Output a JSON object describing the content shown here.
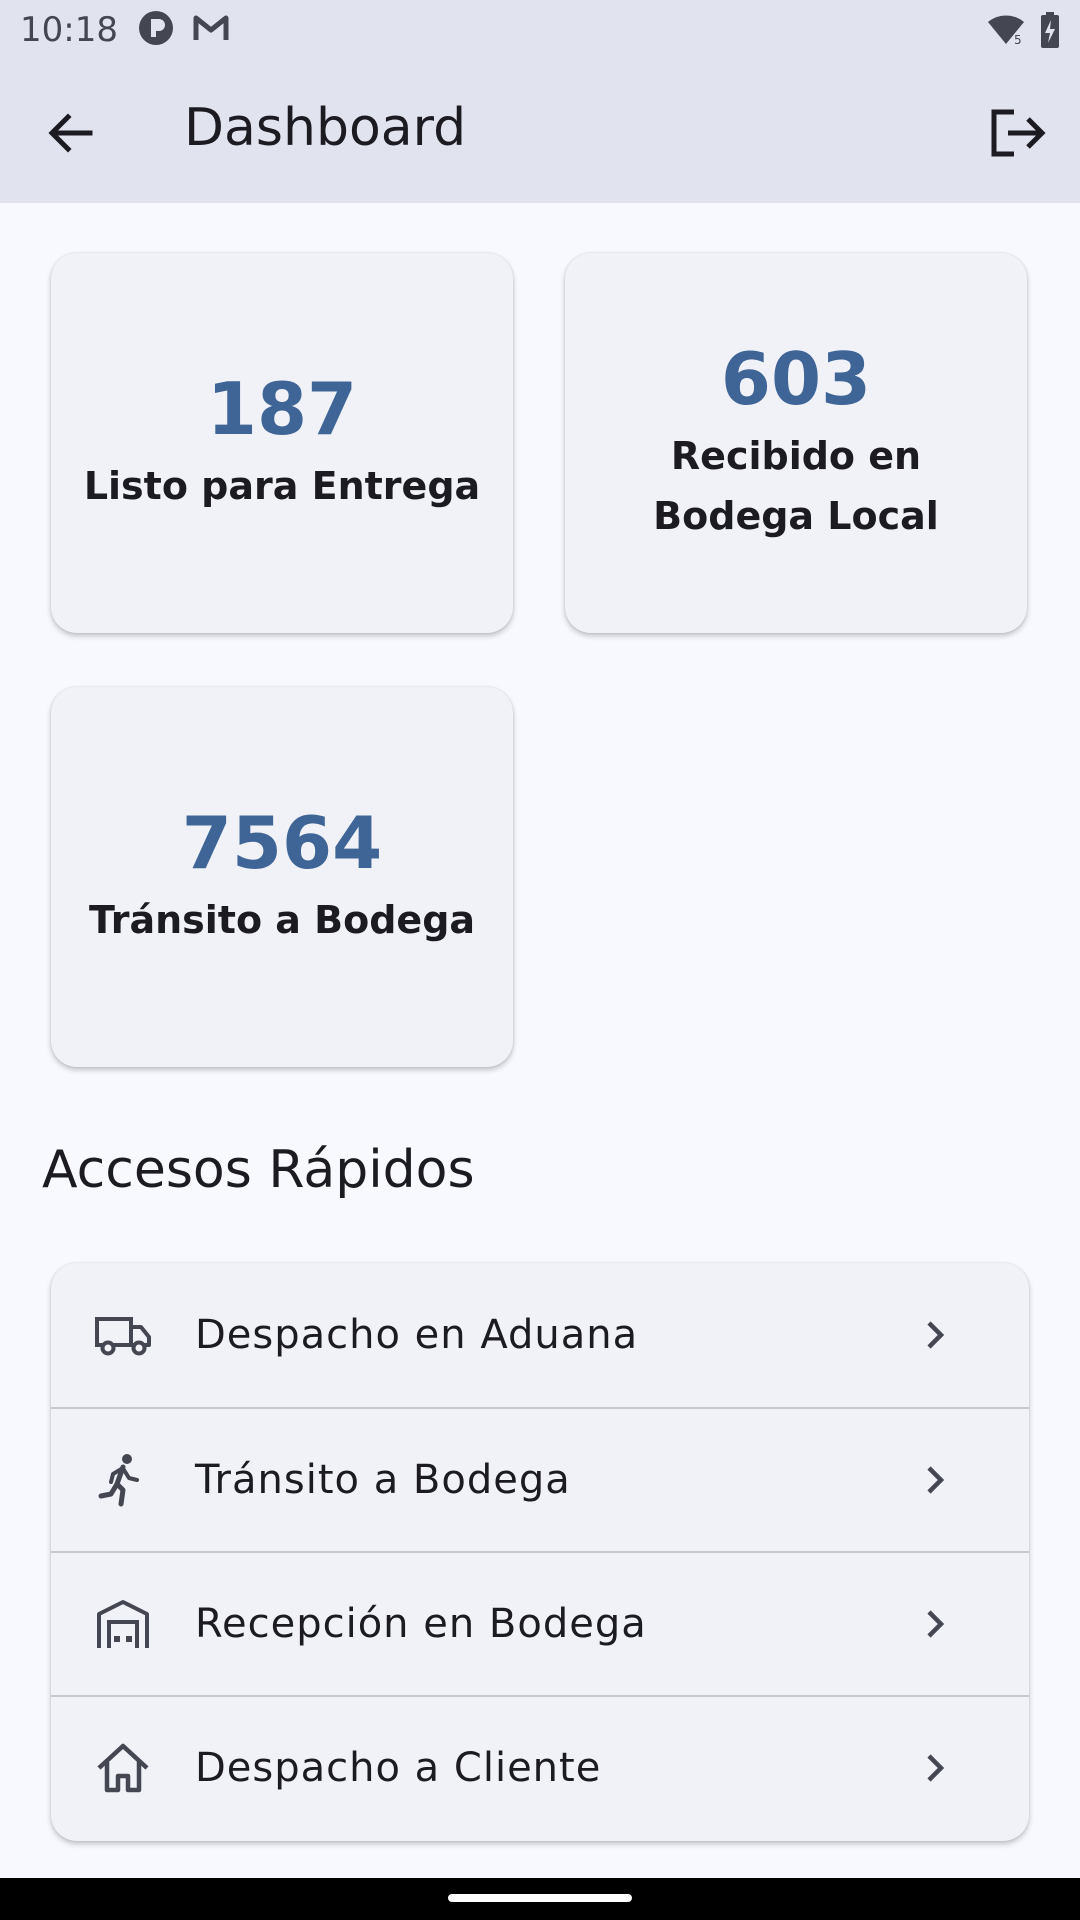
{
  "status_bar": {
    "time": "10:18",
    "icons": [
      "app-notification-icon",
      "gmail-icon",
      "wifi-icon",
      "battery-charging-icon"
    ]
  },
  "app_bar": {
    "title": "Dashboard",
    "back_icon": "arrow-back-icon",
    "logout_icon": "logout-icon"
  },
  "stats": [
    {
      "value": "187",
      "label": "Listo para Entrega"
    },
    {
      "value": "603",
      "label": "Recibido en Bodega Local"
    },
    {
      "value": "7564",
      "label": "Tránsito a Bodega"
    }
  ],
  "quick_access": {
    "title": "Accesos Rápidos",
    "items": [
      {
        "label": "Despacho en Aduana",
        "icon": "truck-icon"
      },
      {
        "label": "Tránsito a Bodega",
        "icon": "running-person-icon"
      },
      {
        "label": "Recepción en Bodega",
        "icon": "warehouse-icon"
      },
      {
        "label": "Despacho a Cliente",
        "icon": "home-icon"
      }
    ]
  },
  "colors": {
    "accent": "#3f6596",
    "app_bar_bg": "#e1e3ef",
    "card_bg": "#f1f2f8",
    "page_bg": "#f8f9ff"
  }
}
